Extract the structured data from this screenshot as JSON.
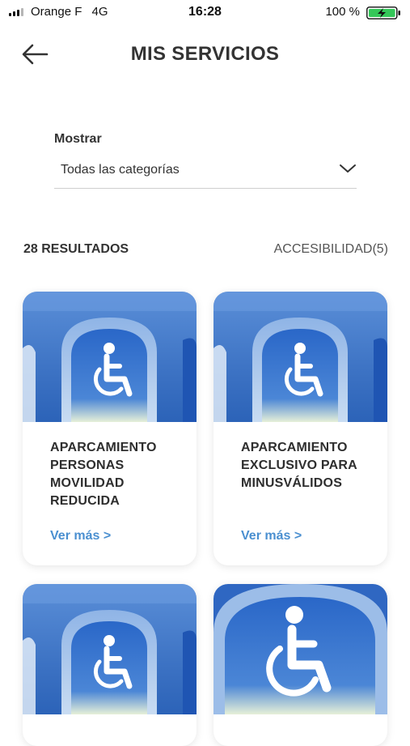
{
  "status_bar": {
    "carrier": "Orange F",
    "network": "4G",
    "time": "16:28",
    "battery": "100 %"
  },
  "header": {
    "title": "MIS SERVICIOS",
    "back_icon": "arrow-left-icon"
  },
  "filter": {
    "label": "Mostrar",
    "selected": "Todas las categorías"
  },
  "results": {
    "count_label": "28 RESULTADOS",
    "category_label": "ACCESIBILIDAD(5)"
  },
  "cards": [
    {
      "title": "APARCAMIENTO PERSONAS MOVILIDAD REDUCIDA",
      "link": "Ver más >"
    },
    {
      "title": "APARCAMIENTO EXCLUSIVO PARA MINUSVÁLIDOS",
      "link": "Ver más >"
    },
    {
      "title": "",
      "link": ""
    },
    {
      "title": "",
      "link": ""
    }
  ],
  "colors": {
    "accent_link": "#4a8fd0",
    "sky_blue": "#3d73c4",
    "battery_green": "#34c759"
  }
}
